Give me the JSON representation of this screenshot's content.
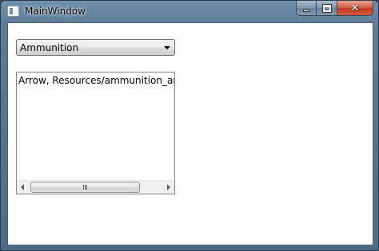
{
  "window": {
    "title": "MainWindow",
    "caption_buttons": {
      "minimize": "minimize-icon",
      "maximize": "maximize-icon",
      "close": "close-icon",
      "close_glyph": "✕"
    }
  },
  "combo": {
    "selected": "Ammunition",
    "icon": "chevron-down-icon"
  },
  "listbox": {
    "items": [
      "Arrow, Resources/ammunition_arrow, sti"
    ]
  },
  "colors": {
    "close_button": "#c2391f",
    "titlebar": "#5d7c98",
    "client": "#ffffff"
  }
}
